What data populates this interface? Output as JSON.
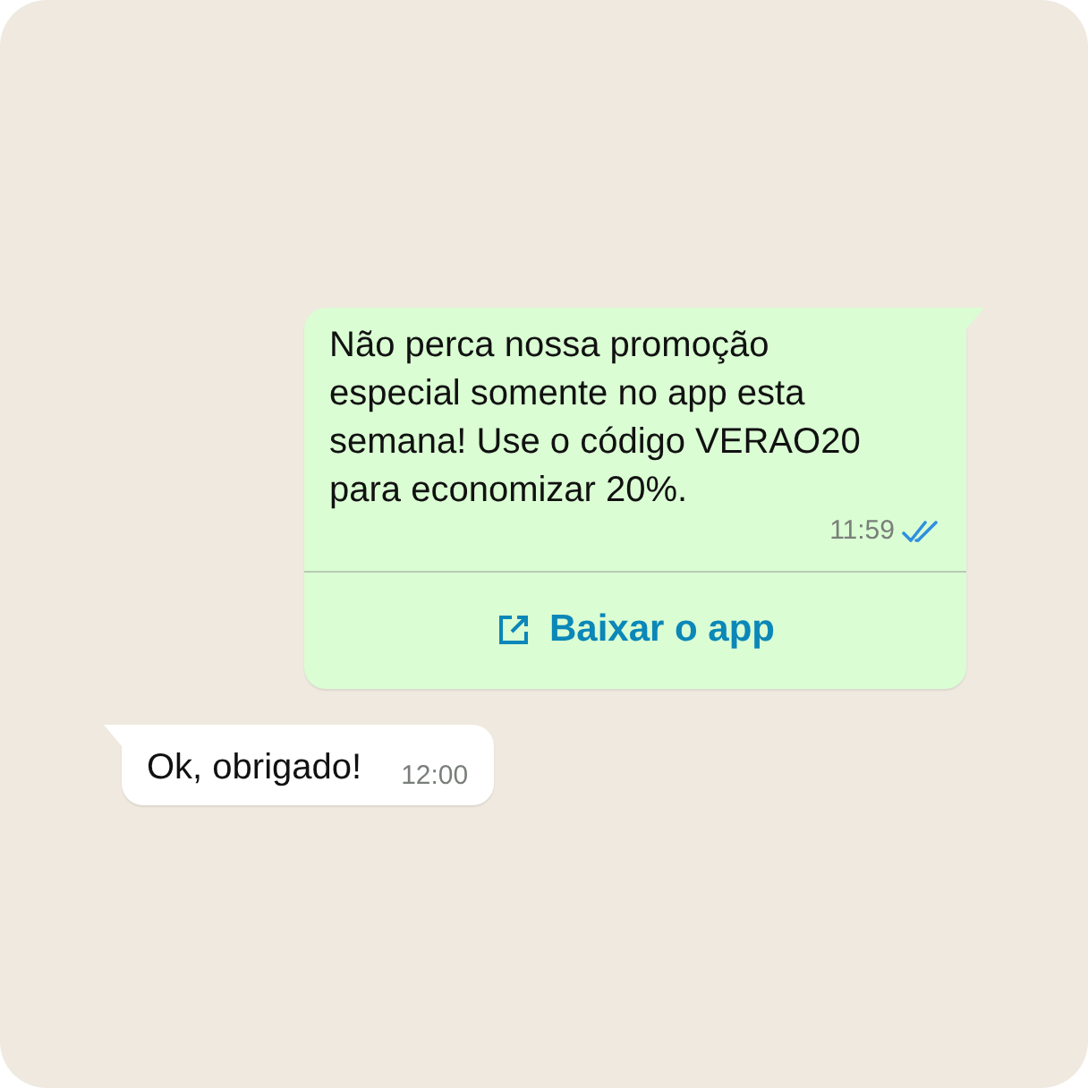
{
  "messages": [
    {
      "kind": "outgoing",
      "text": "Não perca nossa promoção especial somente no app esta semana! Use o código VERAO20 para economizar 20%.",
      "time": "11:59",
      "read": true,
      "action": {
        "label": "Baixar o app"
      }
    },
    {
      "kind": "incoming",
      "text": "Ok, obrigado!",
      "time": "12:00"
    }
  ]
}
